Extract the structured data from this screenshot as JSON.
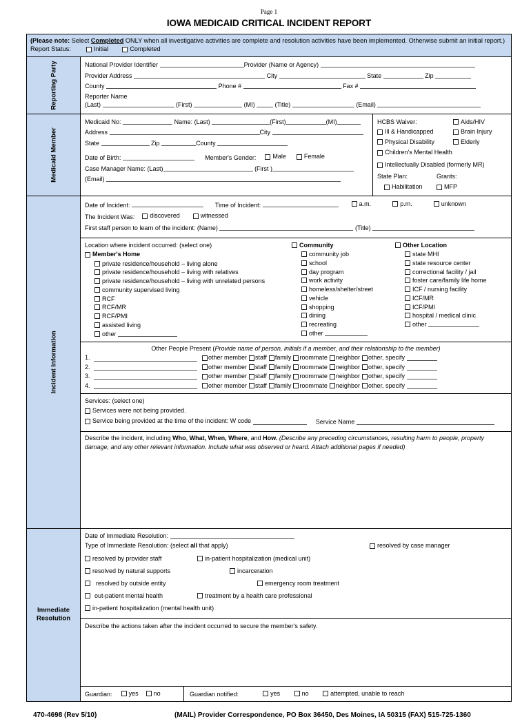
{
  "header": {
    "page_label": "Page 1",
    "title": "IOWA MEDICAID CRITICAL INCIDENT REPORT",
    "note_prefix": "(Please note:",
    "note_select": " Select ",
    "note_completed_word": "Completed",
    "note_body": " ONLY when all investigative activities are complete and resolution activities have been implemented. Otherwise submit an initial report.)",
    "report_status_label": "Report Status:",
    "status_initial": "Initial",
    "status_completed": "Completed"
  },
  "sections": {
    "reporting_party": {
      "title": "Reporting Party",
      "npi_label": "National Provider Identifier",
      "provider_label": "Provider (Name or Agency)",
      "provider_address_label": "Provider Address",
      "city_label": "City",
      "state_label": "State",
      "zip_label": "Zip",
      "county_label": "County",
      "phone_label": "Phone #",
      "fax_label": "Fax #",
      "reporter_name_label": "Reporter Name",
      "last_label": "(Last)",
      "first_label": "(First)",
      "mi_label": "(MI)",
      "title_label": "(Title)",
      "email_label": "(Email)"
    },
    "medicaid_member": {
      "title": "Medicaid Member",
      "medicaid_no_label": "Medicaid No:",
      "name_label": "Name: (Last)",
      "first_label": "(First)",
      "mi_label": "(MI)",
      "address_label": "Address",
      "city_label": "City",
      "state_label": "State",
      "zip_label": "Zip",
      "county_label": "County",
      "dob_label": "Date of Birth:",
      "gender_label": "Member's Gender:",
      "gender_male": "Male",
      "gender_female": "Female",
      "case_manager_label": "Case Manager Name: (Last)",
      "case_manager_first": "(First )",
      "email_label": "(Email)",
      "hcbs_waiver_label": "HCBS Waiver:",
      "waiver_options": [
        "Aids/HIV",
        "Ill & Handicapped",
        "Brain Injury",
        "Physical Disability",
        "Elderly",
        "Children's Mental Health",
        "Intellectually Disabled (formerly MR)"
      ],
      "state_plan_label": "State Plan:",
      "grants_label": "Grants:",
      "state_plan_option": "Habilitation",
      "grants_option": "MFP"
    },
    "incident_information": {
      "title": "Incident Information",
      "date_of_incident_label": "Date of Incident:",
      "time_of_incident_label": "Time of Incident:",
      "am_label": "a.m.",
      "pm_label": "p.m.",
      "unknown_label": "unknown",
      "incident_was_label": "The Incident Was:",
      "discovered_label": "discovered",
      "witnessed_label": "witnessed",
      "first_staff_label": "First staff person to learn of the incident: (Name)",
      "first_staff_title_label": "(Title)",
      "location_prompt": "Location where incident occurred: (select one)",
      "location_groups": [
        {
          "heading": "Member's Home",
          "items": [
            "private residence/household – living alone",
            "private residence/household – living with relatives",
            "private residence/household – living with unrelated persons",
            "community supervised living",
            "RCF",
            "RCF/MR",
            "RCF/PMI",
            "assisted living",
            "other"
          ],
          "last_has_line": true
        },
        {
          "heading": "Community",
          "items": [
            "community job",
            "school",
            "day program",
            "work activity",
            "homeless/shelter/street",
            "vehicle",
            "shopping",
            "dining",
            "recreating",
            "other"
          ],
          "last_has_line": true
        },
        {
          "heading": "Other Location",
          "items": [
            "state MHI",
            "state resource center",
            "correctional facility / jail",
            "foster care/family life home",
            "ICF / nursing facility",
            "ICF/MR",
            "ICF/PMI",
            "hospital / medical clinic",
            "other"
          ],
          "last_has_line": true
        }
      ],
      "other_people_title": "Other People Present (",
      "other_people_title_italic": "Provide name of person, initials if a member, and their relationship to the member)",
      "other_people_rows": [
        "1.",
        "2.",
        "3.",
        "4."
      ],
      "other_people_options": [
        "other member",
        "staff",
        "family",
        "roommate",
        "neighbor",
        "other, specify"
      ],
      "services_label": "Services: (select one)",
      "services_opt1": "Services were not being provided.",
      "services_opt2": "Service being provided at the time of the incident: W code",
      "service_name_label": "Service Name",
      "describe_prefix": "Describe the incident, including ",
      "describe_who": "Who",
      "describe_what": "What,",
      "describe_when": "When,",
      "describe_where": "Where",
      "describe_and": ", and ",
      "describe_how": "How.",
      "describe_italic": " (Describe any preceding circumstances, resulting harm to people, property damage, and any other relevant information. Include what was observed or heard. Attach additional pages if needed)"
    },
    "immediate_resolution": {
      "title": "Immediate Resolution",
      "date_label": "Date of Immediate Resolution:",
      "type_label_pre": "Type of Immediate Resolution: (select ",
      "type_label_bold": "all",
      "type_label_post": " that apply)",
      "options_col1": [
        "resolved by provider staff",
        "incarceration",
        "out-patient mental health"
      ],
      "options_col2": [
        "in-patient hospitalization (medical unit)",
        "resolved by outside entity",
        "treatment by a health care professional"
      ],
      "options_col3": [
        "resolved by case manager",
        "resolved by natural supports",
        "emergency room treatment",
        "in-patient hospitalization (mental health unit)"
      ],
      "actions_prompt": "Describe the actions taken after the incident occurred to secure the member's safety.",
      "guardian_label": "Guardian:",
      "guardian_yes": "yes",
      "guardian_no": "no",
      "guardian_notified_label": "Guardian notified:",
      "notified_yes": "yes",
      "notified_no": "no",
      "notified_attempted": "attempted, unable to reach"
    }
  },
  "footer": {
    "form_number": "470-4698 (Rev 5/10)",
    "mailing": "(MAIL) Provider Correspondence, PO Box 36450, Des Moines, IA 50315 (FAX) 515-725-1360"
  },
  "colors": {
    "sidebar_blue": "#c6d9f0",
    "border": "#000000",
    "line": "#555555"
  }
}
